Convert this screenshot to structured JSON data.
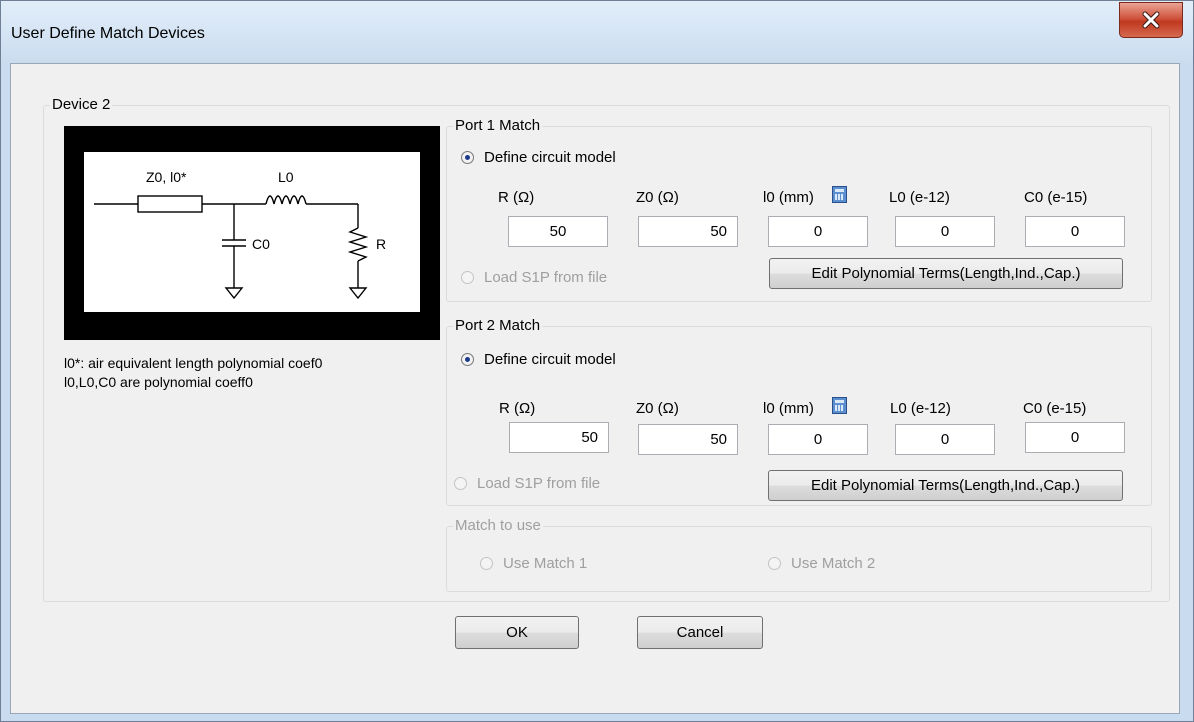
{
  "window": {
    "title": "User Define Match Devices",
    "close_icon": "close-icon"
  },
  "device_group": {
    "label": "Device 2",
    "diagram": {
      "z0_label": "Z0, l0*",
      "l0_label": "L0",
      "c0_label": "C0",
      "r_label": "R"
    },
    "note_line1": "l0*: air equivalent length polynomial coef0",
    "note_line2": "l0,L0,C0 are polynomial coeff0"
  },
  "port1": {
    "label": "Port 1 Match",
    "define_label": "Define circuit model",
    "load_label": "Load S1P from file",
    "fields": [
      {
        "label": "R (Ω)",
        "value": "50"
      },
      {
        "label": "Z0 (Ω)",
        "value": "50"
      },
      {
        "label": "l0 (mm)",
        "value": "0"
      },
      {
        "label": "L0 (e-12)",
        "value": "0"
      },
      {
        "label": "C0 (e-15)",
        "value": "0"
      }
    ],
    "edit_button": "Edit Polynomial Terms(Length,Ind.,Cap.)"
  },
  "port2": {
    "label": "Port 2 Match",
    "define_label": "Define circuit model",
    "load_label": "Load S1P from file",
    "fields": [
      {
        "label": "R (Ω)",
        "value": "50"
      },
      {
        "label": "Z0 (Ω)",
        "value": "50"
      },
      {
        "label": "l0 (mm)",
        "value": "0"
      },
      {
        "label": "L0 (e-12)",
        "value": "0"
      },
      {
        "label": "C0 (e-15)",
        "value": "0"
      }
    ],
    "edit_button": "Edit Polynomial Terms(Length,Ind.,Cap.)"
  },
  "match_to_use": {
    "label": "Match to use",
    "option1": "Use Match 1",
    "option2": "Use Match 2"
  },
  "buttons": {
    "ok": "OK",
    "cancel": "Cancel"
  },
  "colors": {
    "title_bar": "#d6e5f5",
    "close_button": "#c7432b",
    "dialog_bg": "#f0f0f0"
  }
}
